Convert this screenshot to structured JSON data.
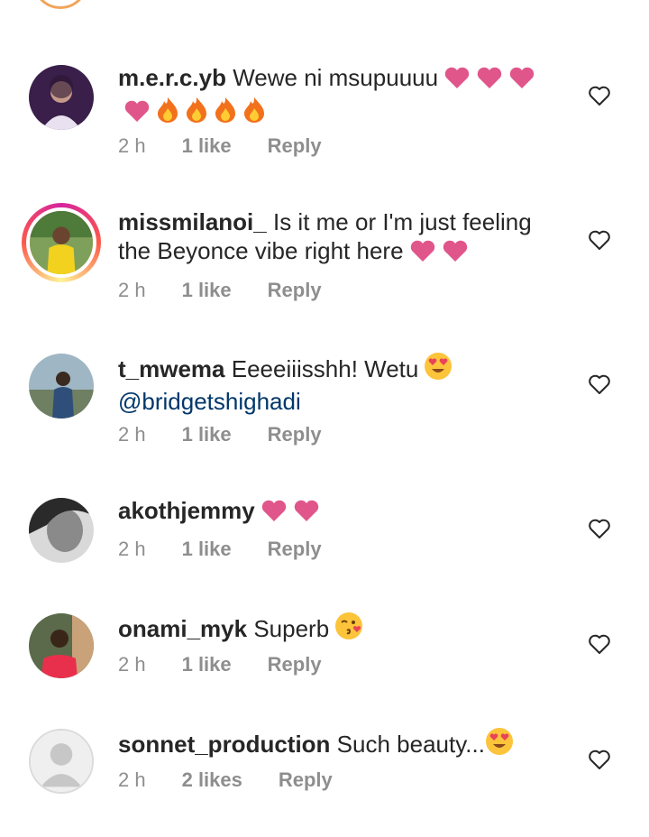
{
  "comments": [
    {
      "username": "m.e.r.c.yb",
      "text": "Wewe ni msupuuuu",
      "emojis": [
        "pink-heart",
        "pink-heart",
        "pink-heart",
        "pink-heart",
        "fire",
        "fire",
        "fire",
        "fire"
      ],
      "time": "2 h",
      "likes": "1 like",
      "reply": "Reply",
      "avatar": "user-photo"
    },
    {
      "username": "missmilanoi_",
      "text": "Is it me or I'm just feeling the Beyonce vibe right here",
      "emojis": [
        "pink-heart",
        "pink-heart"
      ],
      "time": "2 h",
      "likes": "1 like",
      "reply": "Reply",
      "avatar": "user-photo-with-story-ring"
    },
    {
      "username": "t_mwema",
      "text": "Eeeeiiisshh! Wetu",
      "mention": "@bridgetshighadi",
      "emojis": [
        "heart-eyes"
      ],
      "time": "2 h",
      "likes": "1 like",
      "reply": "Reply",
      "avatar": "user-photo"
    },
    {
      "username": "akothjemmy",
      "text": "",
      "emojis": [
        "pink-heart",
        "pink-heart"
      ],
      "time": "2 h",
      "likes": "1 like",
      "reply": "Reply",
      "avatar": "user-photo-grayscale"
    },
    {
      "username": "onami_myk",
      "text": "Superb",
      "emojis": [
        "kissing-face"
      ],
      "time": "2 h",
      "likes": "1 like",
      "reply": "Reply",
      "avatar": "user-photo"
    },
    {
      "username": "sonnet_production",
      "text": "Such beauty...",
      "emojis": [
        "heart-eyes"
      ],
      "time": "2 h",
      "likes": "2 likes",
      "reply": "Reply",
      "avatar": "default-avatar"
    }
  ],
  "colors": {
    "text": "#262626",
    "meta": "#8e8e8e",
    "mention": "#00376b",
    "heart": "#e0568a",
    "fire": "#f2711c"
  }
}
